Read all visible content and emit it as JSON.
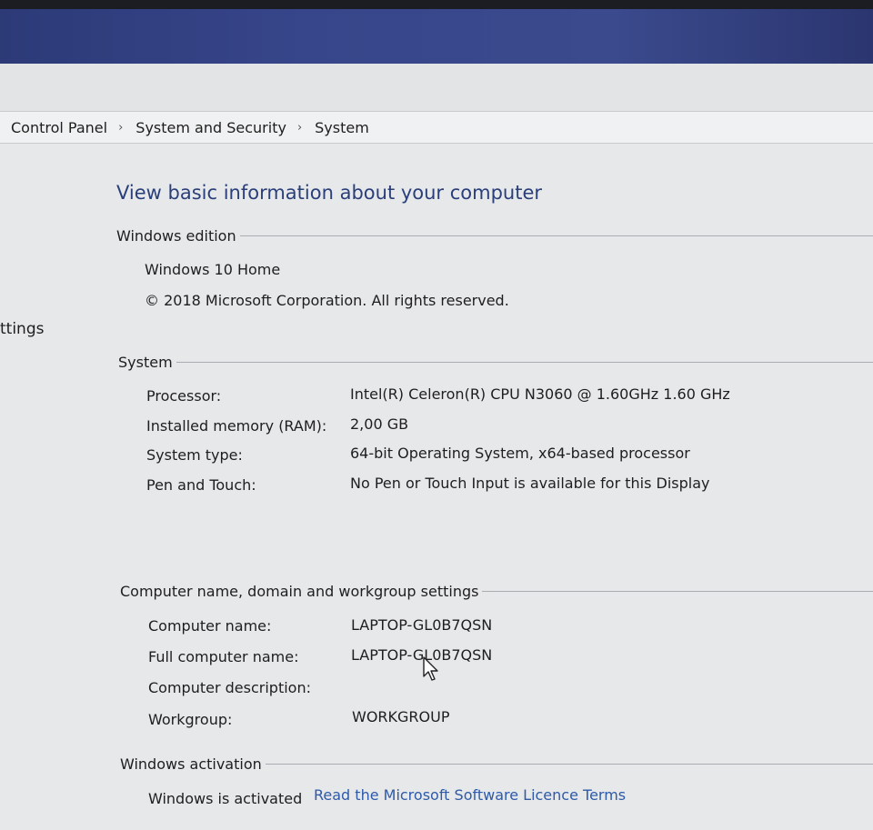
{
  "breadcrumb": [
    "Control Panel",
    "System and Security",
    "System"
  ],
  "breadcrumb_separator": "›",
  "left_panel": {
    "partial_link": "ttings"
  },
  "page_title": "View basic information about your computer",
  "windows_edition": {
    "heading": "Windows edition",
    "edition": "Windows 10 Home",
    "copyright": "© 2018 Microsoft Corporation. All rights reserved."
  },
  "system": {
    "heading": "System",
    "rows": [
      {
        "label": "Processor:",
        "value": "Intel(R) Celeron(R) CPU  N3060  @ 1.60GHz   1.60 GHz"
      },
      {
        "label": "Installed memory (RAM):",
        "value": "2,00 GB"
      },
      {
        "label": "System type:",
        "value": "64-bit Operating System, x64-based processor"
      },
      {
        "label": "Pen and Touch:",
        "value": "No Pen or Touch Input is available for this Display"
      }
    ]
  },
  "computer_name": {
    "heading": "Computer name, domain and workgroup settings",
    "rows": [
      {
        "label": "Computer name:",
        "value": "LAPTOP-GL0B7QSN"
      },
      {
        "label": "Full computer name:",
        "value": "LAPTOP-GL0B7QSN"
      },
      {
        "label": "Computer description:",
        "value": ""
      },
      {
        "label": "Workgroup:",
        "value": "WORKGROUP"
      }
    ]
  },
  "activation": {
    "heading": "Windows activation",
    "status": "Windows is activated",
    "licence_link": "Read the Microsoft Software Licence Terms"
  },
  "colors": {
    "title_blue": "#2a3f7a",
    "link_blue": "#2e5aa8",
    "background": "#e6e8ea"
  }
}
